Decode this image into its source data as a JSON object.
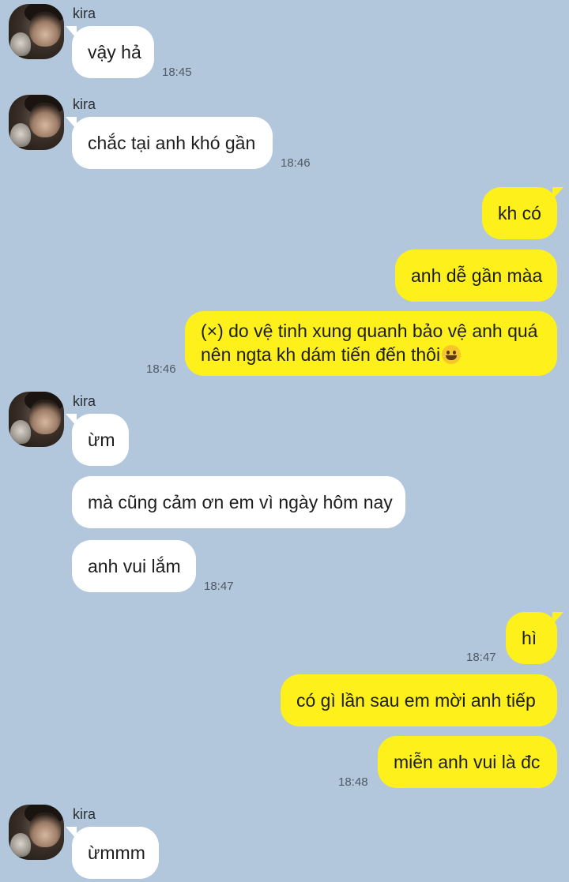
{
  "contact": {
    "name": "kira"
  },
  "messages": [
    {
      "sender": "kira",
      "text": "vậy hả",
      "time": "18:45"
    },
    {
      "sender": "kira",
      "text": "chắc tại anh khó gần",
      "time": "18:46"
    },
    {
      "sender": "me",
      "text": "kh có"
    },
    {
      "sender": "me",
      "text": "anh dễ gần màa"
    },
    {
      "sender": "me",
      "text_line1": "(×) do vệ tinh xung quanh bảo vệ anh quá",
      "text_line2": "nên ngta kh dám tiến đến thôi",
      "emoji": "grinning-face",
      "time": "18:46"
    },
    {
      "sender": "kira",
      "text": "ừm"
    },
    {
      "sender": "kira",
      "text": "mà cũng cảm ơn em vì ngày hôm nay"
    },
    {
      "sender": "kira",
      "text": "anh vui lắm",
      "time": "18:47"
    },
    {
      "sender": "me",
      "text": "hì",
      "time": "18:47"
    },
    {
      "sender": "me",
      "text": "có gì lần sau em mời anh tiếp"
    },
    {
      "sender": "me",
      "text": "miễn anh vui là đc",
      "time": "18:48"
    },
    {
      "sender": "kira",
      "text": "ừmmm"
    }
  ],
  "colors": {
    "background": "#b2c7dc",
    "incoming_bubble": "#ffffff",
    "outgoing_bubble": "#fef01b"
  }
}
